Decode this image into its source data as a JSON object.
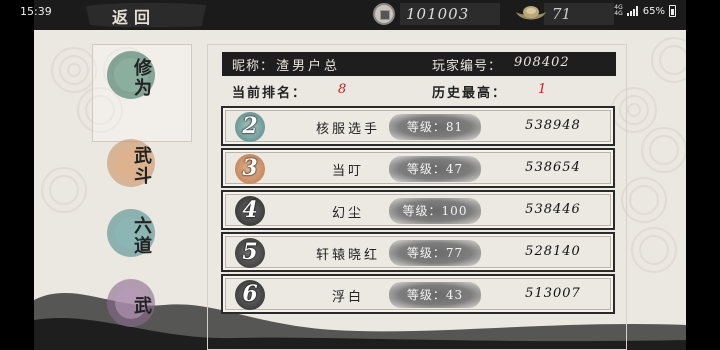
{
  "status_bar": {
    "time": "15:39",
    "network": "4G",
    "network_sub": "4G",
    "battery": "65%"
  },
  "top_bar": {
    "back_label": "返回",
    "copper_coins": "101003",
    "gold_ingots": "71"
  },
  "tabs": [
    {
      "label": "修为",
      "icon": "ink-circle-green"
    },
    {
      "label": "武斗",
      "icon": "ink-circle-orange"
    },
    {
      "label": "六道",
      "icon": "ink-circle-teal"
    },
    {
      "label": "武",
      "icon": "ink-circle-purple"
    }
  ],
  "player": {
    "nick_label": "昵称：",
    "nick_value": "渣男户总",
    "id_label": "玩家编号：",
    "id_value": "908402",
    "rank_label": "当前排名：",
    "rank_value": "8",
    "best_label": "历史最高：",
    "best_value": "1"
  },
  "ranking": [
    {
      "rank": "2",
      "name": "核服选手",
      "level": "等级：81",
      "score": "538948",
      "badge_color": "#7fa8a4"
    },
    {
      "rank": "3",
      "name": "当叮",
      "level": "等级：47",
      "score": "538654",
      "badge_color": "#c98a63"
    },
    {
      "rank": "4",
      "name": "幻尘",
      "level": "等级：100",
      "score": "538446",
      "badge_color": "#4d4d4d"
    },
    {
      "rank": "5",
      "name": "轩辕晓红",
      "level": "等级：77",
      "score": "528140",
      "badge_color": "#5a5a5a"
    },
    {
      "rank": "6",
      "name": "浮白",
      "level": "等级：43",
      "score": "513007",
      "badge_color": "#555555"
    }
  ],
  "colors": {
    "paper": "#ebe7e1",
    "ink": "#1b1b1b",
    "highlight_red": "#c42020"
  }
}
